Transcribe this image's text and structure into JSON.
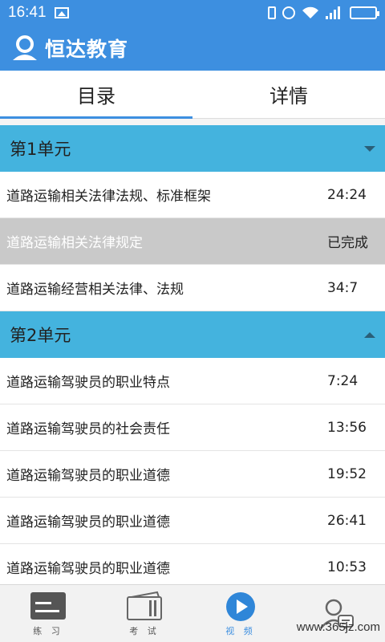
{
  "status_bar": {
    "time": "16:41",
    "network": "4G"
  },
  "app": {
    "title": "恒达教育"
  },
  "tabs": [
    {
      "label": "目录",
      "active": true
    },
    {
      "label": "详情",
      "active": false
    }
  ],
  "units": [
    {
      "title": "第1单元",
      "expanded": true,
      "lessons": [
        {
          "title": "道路运输相关法律法规、标准框架",
          "duration": "24:24"
        },
        {
          "title": "道路运输相关法律规定",
          "duration": "已完成",
          "completed": true
        },
        {
          "title": "道路运输经营相关法律、法规",
          "duration": "34:7"
        }
      ]
    },
    {
      "title": "第2单元",
      "expanded": true,
      "lessons": [
        {
          "title": "道路运输驾驶员的职业特点",
          "duration": "7:24"
        },
        {
          "title": "道路运输驾驶员的社会责任",
          "duration": "13:56"
        },
        {
          "title": "道路运输驾驶员的职业道德",
          "duration": "19:52"
        },
        {
          "title": "道路运输驾驶员的职业道德",
          "duration": "26:41"
        },
        {
          "title": "道路运输驾驶员的职业道德",
          "duration": "10:53"
        }
      ]
    }
  ],
  "bottom_nav": [
    {
      "label": "练 习",
      "icon": "practice-icon"
    },
    {
      "label": "考 试",
      "icon": "exam-icon"
    },
    {
      "label": "视 频",
      "icon": "video-play-icon",
      "active": true
    },
    {
      "label": "",
      "icon": "profile-icon"
    }
  ],
  "watermark": "www.365jz.com",
  "colors": {
    "primary": "#3d8fe0",
    "unit_header": "#44b3de",
    "completed_row": "#c9c9c9"
  }
}
